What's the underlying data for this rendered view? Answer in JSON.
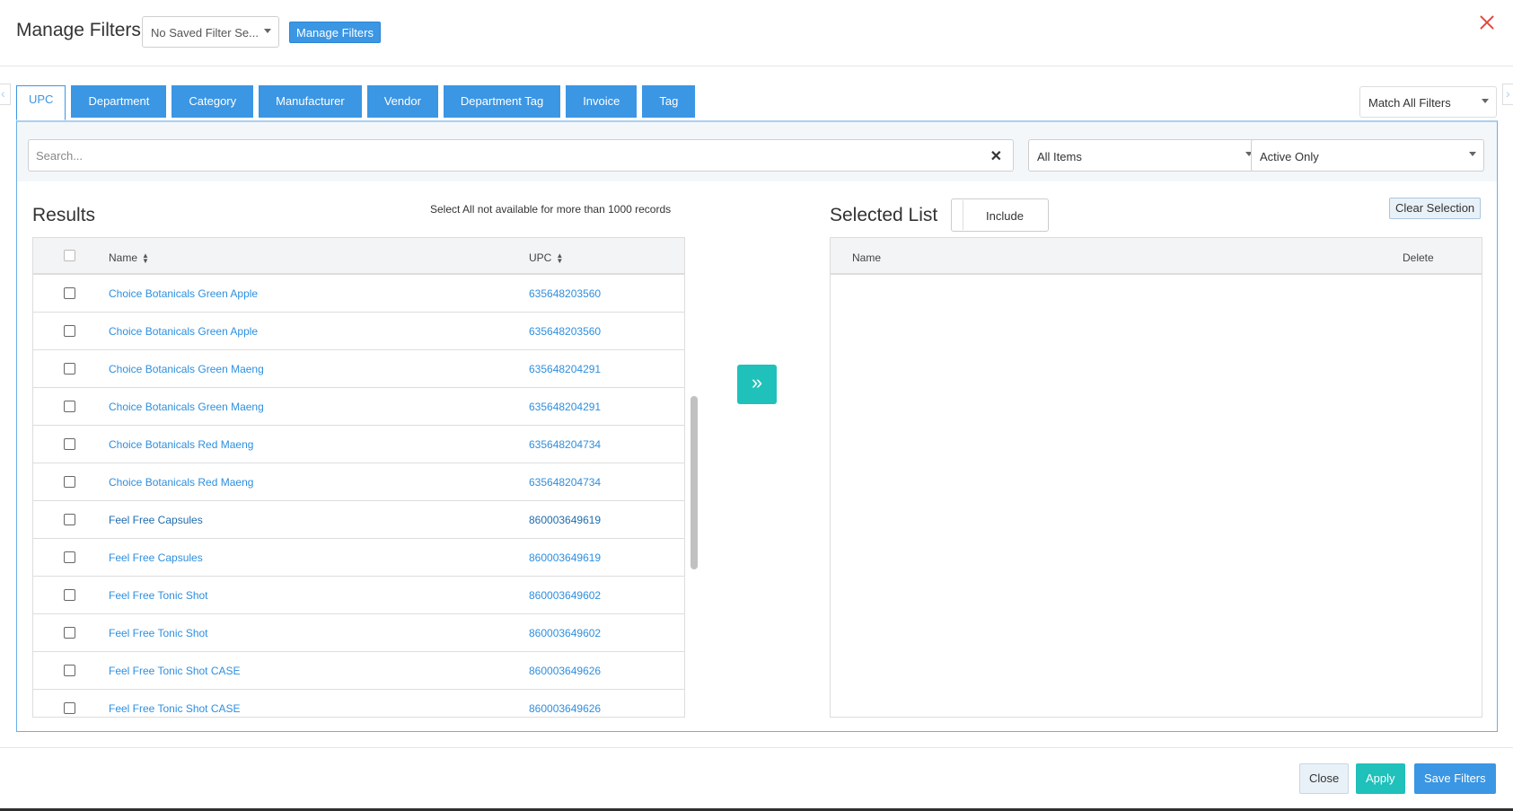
{
  "header": {
    "title": "Manage Filters",
    "saved_filter": "No Saved Filter Se...",
    "manage_button": "Manage Filters"
  },
  "tabs": [
    {
      "label": "UPC",
      "active": true
    },
    {
      "label": "Department"
    },
    {
      "label": "Category"
    },
    {
      "label": "Manufacturer"
    },
    {
      "label": "Vendor"
    },
    {
      "label": "Department Tag"
    },
    {
      "label": "Invoice"
    },
    {
      "label": "Tag"
    }
  ],
  "match_mode": "Match All Filters",
  "search": {
    "placeholder": "Search...",
    "items_filter": "All Items",
    "status_filter": "Active Only"
  },
  "results": {
    "title": "Results",
    "note": "Select All not available for more than 1000 records",
    "col_name": "Name",
    "col_upc": "UPC",
    "rows": [
      {
        "name": "Choice Botanicals Green Apple",
        "upc": "635648203560"
      },
      {
        "name": "Choice Botanicals Green Apple",
        "upc": "635648203560"
      },
      {
        "name": "Choice Botanicals Green Maeng",
        "upc": "635648204291"
      },
      {
        "name": "Choice Botanicals Green Maeng",
        "upc": "635648204291"
      },
      {
        "name": "Choice Botanicals Red Maeng",
        "upc": "635648204734"
      },
      {
        "name": "Choice Botanicals Red Maeng",
        "upc": "635648204734"
      },
      {
        "name": "Feel Free Capsules",
        "upc": "860003649619"
      },
      {
        "name": "Feel Free Capsules",
        "upc": "860003649619"
      },
      {
        "name": "Feel Free Tonic Shot",
        "upc": "860003649602"
      },
      {
        "name": "Feel Free Tonic Shot",
        "upc": "860003649602"
      },
      {
        "name": "Feel Free Tonic Shot CASE",
        "upc": "860003649626"
      },
      {
        "name": "Feel Free Tonic Shot CASE",
        "upc": "860003649626"
      }
    ]
  },
  "move_icon": "double-chevron-right",
  "selected": {
    "title": "Selected List",
    "toggle_label": "Include",
    "clear_button": "Clear Selection",
    "col_name": "Name",
    "col_delete": "Delete"
  },
  "footer": {
    "close": "Close",
    "apply": "Apply",
    "save": "Save Filters"
  },
  "colors": {
    "primary": "#3b96e4",
    "teal": "#1fc1ba",
    "danger": "#e0483e",
    "link": "#2e8fdf"
  }
}
